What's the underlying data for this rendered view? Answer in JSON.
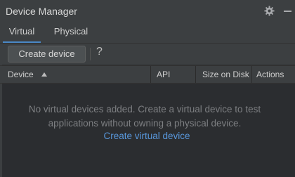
{
  "window": {
    "title": "Device Manager"
  },
  "tabs": [
    {
      "label": "Virtual",
      "selected": true
    },
    {
      "label": "Physical",
      "selected": false
    }
  ],
  "toolbar": {
    "create_label": "Create device",
    "help_label": "?"
  },
  "table": {
    "columns": [
      "Device",
      "API",
      "Size on Disk",
      "Actions"
    ],
    "sort_column": "Device",
    "sort_direction": "ascending"
  },
  "empty_state": {
    "line1": "No virtual devices added. Create a virtual device to test",
    "line2": "applications without owning a physical device.",
    "link_label": "Create virtual device"
  },
  "colors": {
    "accent": "#4a88c7",
    "link": "#5897db",
    "background": "#2b2d30"
  },
  "icons": [
    "gear-icon",
    "minimize-icon",
    "sort-ascending-icon"
  ]
}
